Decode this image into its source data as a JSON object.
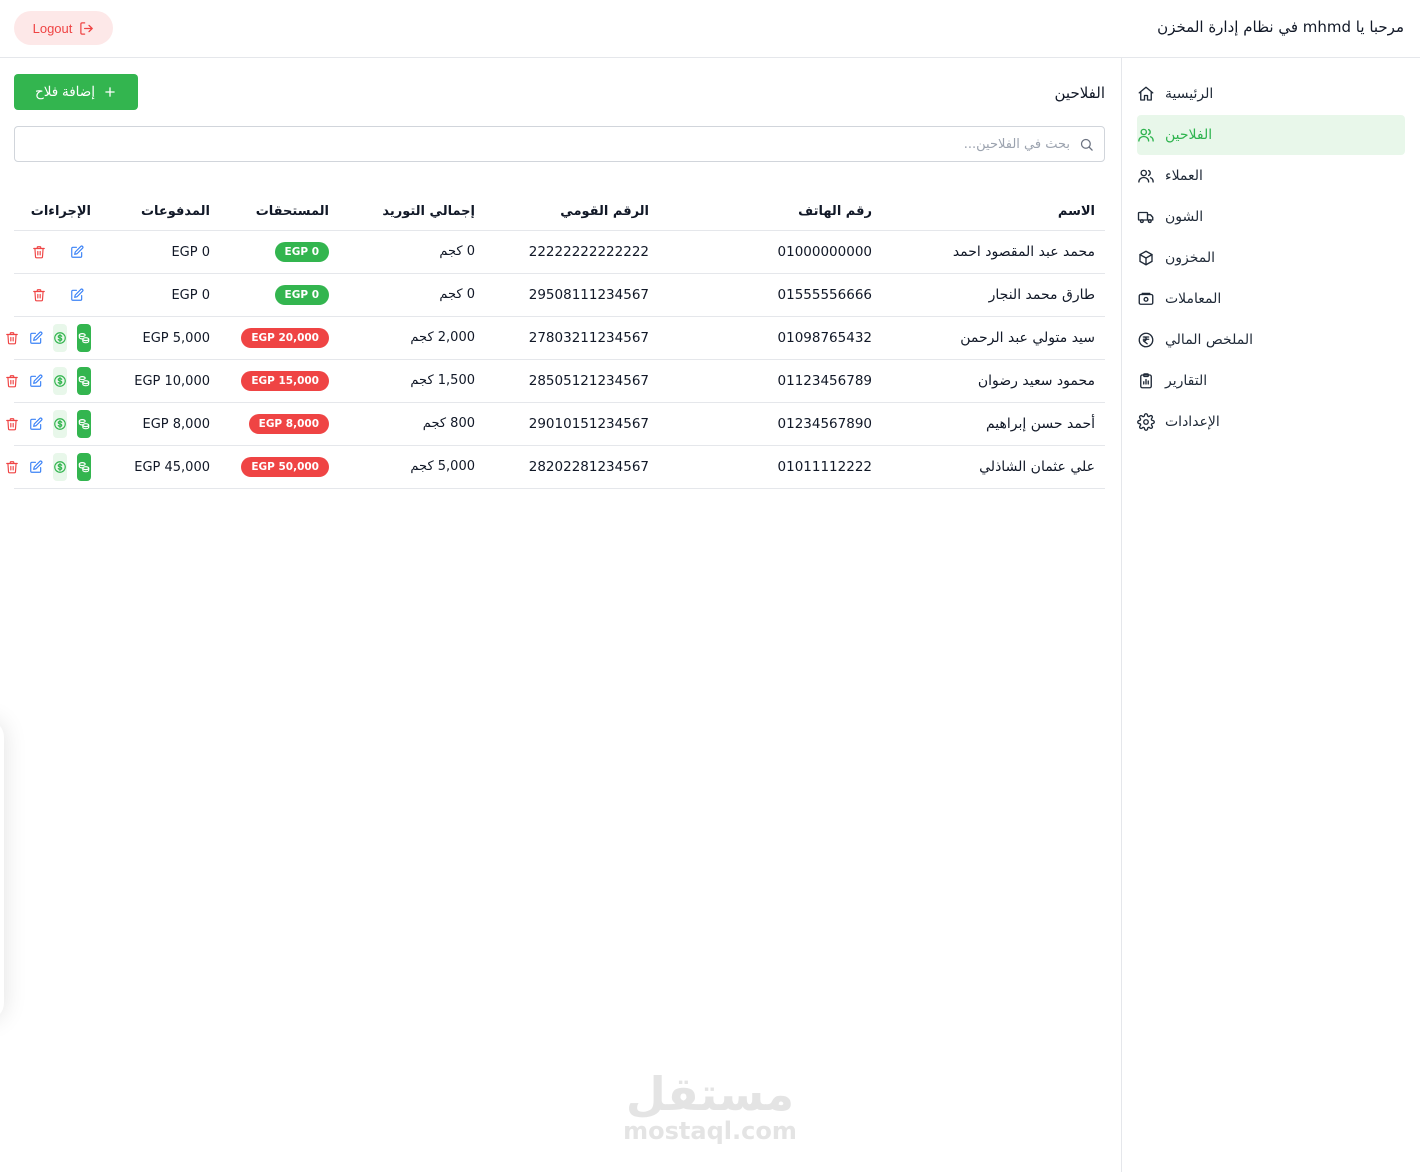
{
  "header": {
    "welcome": "مرحبا يا mhmd في نظام إدارة المخزن",
    "logout_label": "Logout"
  },
  "sidebar": {
    "items": [
      {
        "label": "الرئيسية",
        "icon": "home-icon",
        "active": false
      },
      {
        "label": "الفلاحين",
        "icon": "users-icon",
        "active": true
      },
      {
        "label": "العملاء",
        "icon": "users-icon",
        "active": false
      },
      {
        "label": "الشون",
        "icon": "truck-icon",
        "active": false
      },
      {
        "label": "المخزون",
        "icon": "box-icon",
        "active": false
      },
      {
        "label": "المعاملات",
        "icon": "wallet-icon",
        "active": false
      },
      {
        "label": "الملخص المالي",
        "icon": "currency-icon",
        "active": false
      },
      {
        "label": "التقارير",
        "icon": "clipboard-icon",
        "active": false
      },
      {
        "label": "الإعدادات",
        "icon": "gear-icon",
        "active": false
      }
    ]
  },
  "main": {
    "title": "الفلاحين",
    "add_button_label": "إضافة فلاح",
    "search_placeholder": "بحث في الفلاحين...",
    "columns": [
      "الاسم",
      "رقم الهاتف",
      "الرقم القومي",
      "إجمالي التوريد",
      "المستحقات",
      "المدفوعات",
      "الإجراءات"
    ],
    "rows": [
      {
        "name": "محمد عبد المقصود احمد",
        "phone": "01000000000",
        "national_id": "22222222222222",
        "supply": "0 كجم",
        "dues": "EGP 0",
        "dues_status": "green",
        "paid": "EGP 0",
        "has_payment_actions": false
      },
      {
        "name": "طارق محمد النجار",
        "phone": "01555556666",
        "national_id": "29508111234567",
        "supply": "0 كجم",
        "dues": "EGP 0",
        "dues_status": "green",
        "paid": "EGP 0",
        "has_payment_actions": false
      },
      {
        "name": "سيد متولي عبد الرحمن",
        "phone": "01098765432",
        "national_id": "27803211234567",
        "supply": "2,000 كجم",
        "dues": "EGP 20,000",
        "dues_status": "red",
        "paid": "EGP 5,000",
        "has_payment_actions": true
      },
      {
        "name": "محمود سعيد رضوان",
        "phone": "01123456789",
        "national_id": "28505121234567",
        "supply": "1,500 كجم",
        "dues": "EGP 15,000",
        "dues_status": "red",
        "paid": "EGP 10,000",
        "has_payment_actions": true
      },
      {
        "name": "أحمد حسن إبراهيم",
        "phone": "01234567890",
        "national_id": "29010151234567",
        "supply": "800 كجم",
        "dues": "EGP 8,000",
        "dues_status": "red",
        "paid": "EGP 8,000",
        "has_payment_actions": true
      },
      {
        "name": "علي عثمان الشاذلي",
        "phone": "01011112222",
        "national_id": "28202281234567",
        "supply": "5,000 كجم",
        "dues": "EGP 50,000",
        "dues_status": "red",
        "paid": "EGP 45,000",
        "has_payment_actions": true
      }
    ]
  },
  "watermark": {
    "arabic": "مستقل",
    "latin": "mostaql.com"
  },
  "colors": {
    "accent": "#33b54f",
    "danger": "#ef4444",
    "link": "#3b82f6",
    "active_bg": "#e8f7ea"
  }
}
